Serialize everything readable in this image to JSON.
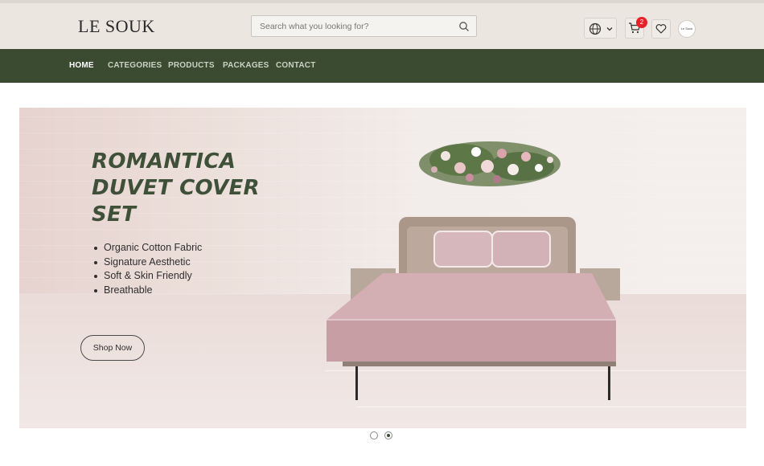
{
  "header": {
    "logo_text": "LE SOUK",
    "search_placeholder": "Search what you looking for?",
    "cart_count": "2",
    "avatar_text": "Le Souk"
  },
  "nav": {
    "items": [
      {
        "label": "HOME",
        "active": true
      },
      {
        "label": "CATEGORIES",
        "active": false
      },
      {
        "label": "PRODUCTS",
        "active": false
      },
      {
        "label": "PACKAGES",
        "active": false
      },
      {
        "label": "CONTACT",
        "active": false
      }
    ]
  },
  "hero": {
    "title_lines": [
      "ROMANTICA",
      "DUVET COVER",
      "SET"
    ],
    "features": [
      "Organic Cotton Fabric",
      "Signature Aesthetic",
      "Soft & Skin Friendly",
      "Breathable"
    ],
    "cta_label": "Shop Now",
    "slide_count": 2,
    "active_slide": 2
  },
  "colors": {
    "nav_bg": "#3a4b32",
    "title": "#3f5039",
    "badge": "#e8202a",
    "topbar_bg": "#ebe6e0"
  },
  "icons": [
    "search-icon",
    "globe-icon",
    "chevron-down-icon",
    "cart-icon",
    "heart-icon"
  ]
}
